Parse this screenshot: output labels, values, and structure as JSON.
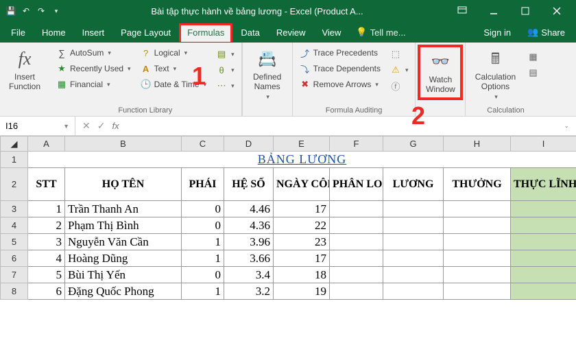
{
  "titlebar": {
    "title": "Bài tập thực hành về bảng lương - Excel (Product A..."
  },
  "menu": {
    "file": "File",
    "home": "Home",
    "insert": "Insert",
    "pagelayout": "Page Layout",
    "formulas": "Formulas",
    "data": "Data",
    "review": "Review",
    "view": "View",
    "tellme": "Tell me...",
    "signin": "Sign in",
    "share": "Share"
  },
  "ribbon": {
    "insertFunction": "Insert\nFunction",
    "autosum": "AutoSum",
    "recent": "Recently Used",
    "financial": "Financial",
    "logical": "Logical",
    "text": "Text",
    "datetime": "Date & Time",
    "definedNames": "Defined\nNames",
    "tracePrec": "Trace Precedents",
    "traceDep": "Trace Dependents",
    "removeArr": "Remove Arrows",
    "watchWindow": "Watch\nWindow",
    "calcOptions": "Calculation\nOptions",
    "grp_funclib": "Function Library",
    "grp_audit": "Formula Auditing",
    "grp_calc": "Calculation"
  },
  "formula_bar": {
    "cell": "I16"
  },
  "annotations": {
    "a1": "1",
    "a2": "2"
  },
  "sheet": {
    "cols": [
      "A",
      "B",
      "C",
      "D",
      "E",
      "F",
      "G",
      "H",
      "I"
    ],
    "title": "BẢNG LƯƠNG",
    "headers": {
      "stt": "STT",
      "hoten": "HỌ TÊN",
      "phai": "PHÁI",
      "heso": "HỆ SỐ",
      "ngaycong": "NGÀY CÔNG",
      "phanloai": "PHÂN LOẠI",
      "luong": "LƯƠNG",
      "thuong": "THƯỞNG",
      "thuclinh": "THỰC LĨNH"
    },
    "rows": [
      {
        "r": 3,
        "stt": 1,
        "hoten": "Trần Thanh An",
        "phai": 0,
        "heso": 4.46,
        "ngaycong": 17
      },
      {
        "r": 4,
        "stt": 2,
        "hoten": "Phạm Thị Bình",
        "phai": 0,
        "heso": 4.36,
        "ngaycong": 22
      },
      {
        "r": 5,
        "stt": 3,
        "hoten": "Nguyễn Văn Cần",
        "phai": 1,
        "heso": 3.96,
        "ngaycong": 23
      },
      {
        "r": 6,
        "stt": 4,
        "hoten": "Hoàng Dũng",
        "phai": 1,
        "heso": 3.66,
        "ngaycong": 17
      },
      {
        "r": 7,
        "stt": 5,
        "hoten": "Bùi Thị Yến",
        "phai": 0,
        "heso": 3.4,
        "ngaycong": 18
      },
      {
        "r": 8,
        "stt": 6,
        "hoten": "Đặng Quốc Phong",
        "phai": 1,
        "heso": 3.2,
        "ngaycong": 19
      }
    ]
  }
}
